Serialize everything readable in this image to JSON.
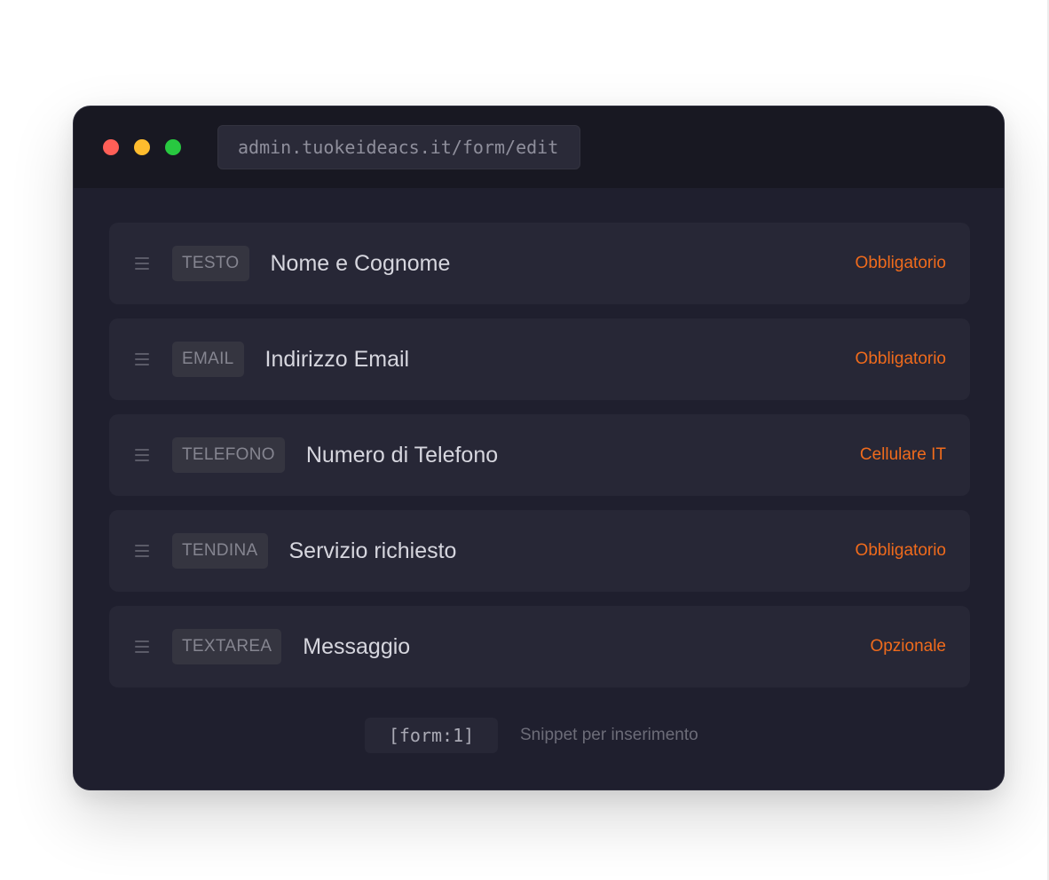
{
  "window": {
    "url": "admin.tuokeideacs.it/form/edit",
    "controls": {
      "close_color": "#ff5f57",
      "minimize_color": "#febc2e",
      "zoom_color": "#28c840"
    }
  },
  "fields": [
    {
      "type": "TESTO",
      "name": "Nome e Cognome",
      "rule": "Obbligatorio"
    },
    {
      "type": "EMAIL",
      "name": "Indirizzo Email",
      "rule": "Obbligatorio"
    },
    {
      "type": "TELEFONO",
      "name": "Numero di Telefono",
      "rule": "Cellulare IT"
    },
    {
      "type": "TENDINA",
      "name": "Servizio richiesto",
      "rule": "Obbligatorio"
    },
    {
      "type": "TEXTAREA",
      "name": "Messaggio",
      "rule": "Opzionale"
    }
  ],
  "footer": {
    "snippet": "[form:1]",
    "hint": "Snippet per inserimento"
  },
  "icons": {
    "drag_handle": "drag-handle-icon"
  },
  "colors": {
    "accent": "#f06b1c",
    "window_bg": "#1f1f2e",
    "titlebar_bg": "#181822",
    "row_bg": "#272736"
  }
}
